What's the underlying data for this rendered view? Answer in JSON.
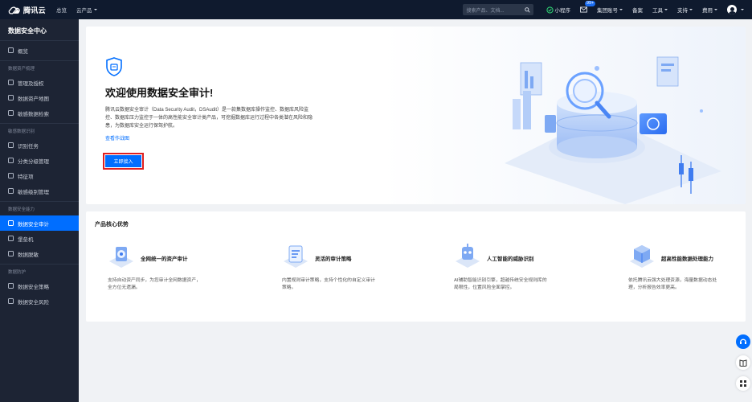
{
  "topbar": {
    "brand": "腾讯云",
    "nav": [
      "总览",
      "云产品"
    ],
    "search_placeholder": "搜索产品、文档...",
    "mini_program": "小程序",
    "badge": "99+",
    "account": "集团账号",
    "record": "备案",
    "tools": "工具",
    "support": "支持",
    "billing": "费用"
  },
  "sidebar": {
    "title": "数据安全中心",
    "overview": "概览",
    "groups": [
      {
        "label": "数据资产梳理",
        "items": [
          "管理及授权",
          "数据资产地图",
          "敏感数据检索"
        ]
      },
      {
        "label": "敏感数据识别",
        "items": [
          "识别任务",
          "分类分级管理",
          "特征项",
          "敏感级别管理"
        ]
      },
      {
        "label": "数据安全能力",
        "items": [
          "数据安全审计",
          "堡垒机",
          "数据脱敏"
        ]
      },
      {
        "label": "数据防护",
        "items": [
          "数据安全策略",
          "数据安全风险"
        ]
      }
    ],
    "active": "数据安全审计"
  },
  "hero": {
    "title": "欢迎使用数据安全审计!",
    "description": "腾讯云数据安全审计（Data Security Audit，DSAudit）是一款集数据库操作监控、数据库风险监控、数据库压力监控于一体的高性能安全审计类产品，可挖掘数据库运行过程中各类潜在风险和隐患，为数据库安全运行保驾护航。",
    "link": "查看作战图",
    "button": "立即接入"
  },
  "advantages": {
    "title": "产品核心优势",
    "items": [
      {
        "name": "全网统一的资产审计",
        "desc": "支持自动资产同步，为您审计全网数据资产，全方位无遗漏。"
      },
      {
        "name": "灵活的审计策略",
        "desc": "内置规则审计策略，支持个性化的自定义审计策略。"
      },
      {
        "name": "人工智能的威胁识别",
        "desc": "AI辅助智能识别引擎，超越传统安全规则库的局限性，位置风险全面掌控。"
      },
      {
        "name": "超高性能数据处理能力",
        "desc": "依托腾讯云强大处理资源，海量数据动态处理，分析报告效率更高。"
      }
    ]
  },
  "colors": {
    "accent": "#006eff",
    "sidebar_bg": "#1d2434",
    "topbar_bg": "#0f1a2e",
    "highlight": "#e02020"
  }
}
